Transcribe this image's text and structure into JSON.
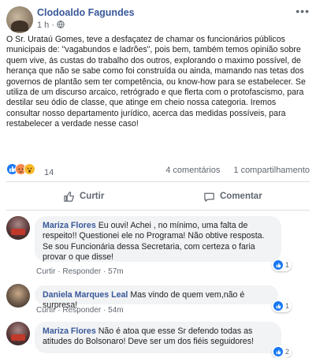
{
  "post": {
    "author": "Clodoaldo Fagundes",
    "time": "1 h",
    "separator": "·",
    "more": "•••",
    "text": "O Sr. Urataú Gomes, teve a desfaçatez de chamar os funcionários públicos municipais de: \"vagabundos e ladrões\", pois bem, também temos opinião sobre quem vive, ás custas do trabalho dos outros, explorando o maximo possível, de herança que não se sabe como foi construída ou ainda, mamando nas tetas dos governos de plantão sem ter competência, ou know-how para se estabelecer. Se utiliza de um discurso arcaico, retrógrado e que flerta com o protofascismo, para destilar seu ódio de classe, que atinge em cheio nossa categoria. Iremos consultar nosso departamento jurídico, acerca das medidas possíveis, para restabelecer a verdade nesse caso!",
    "reaction_count": "14",
    "comments_count": "4 comentários",
    "shares_count": "1 compartilhamento"
  },
  "actions": {
    "like": "Curtir",
    "comment": "Comentar"
  },
  "comments": [
    {
      "name": "Mariza Flores",
      "text": "Eu ouvi! Achei , no mínimo, uma falta de respeito!! Questionei ele no Programa! Não obtive resposta. Se sou Funcionária dessa Secretaria, com certeza o faria provar o que disse!",
      "like": "Curtir",
      "reply": "Responder",
      "time": "57m",
      "likes": "1"
    },
    {
      "name": "Daniela Marques Leal",
      "text": "Mas vindo de quem vem,não é surpresa!",
      "like": "Curtir",
      "reply": "Responder",
      "time": "54m",
      "likes": "1"
    },
    {
      "name": "Mariza Flores",
      "text": "Não é atoa que esse Sr defendo todas as atitudes do Bolsonaro! Deve ser um dos fiéis seguidores!",
      "likes": "2"
    }
  ],
  "colors": {
    "link": "#385898",
    "like_blue": "#1877f2",
    "bubble": "#f2f3f5"
  }
}
